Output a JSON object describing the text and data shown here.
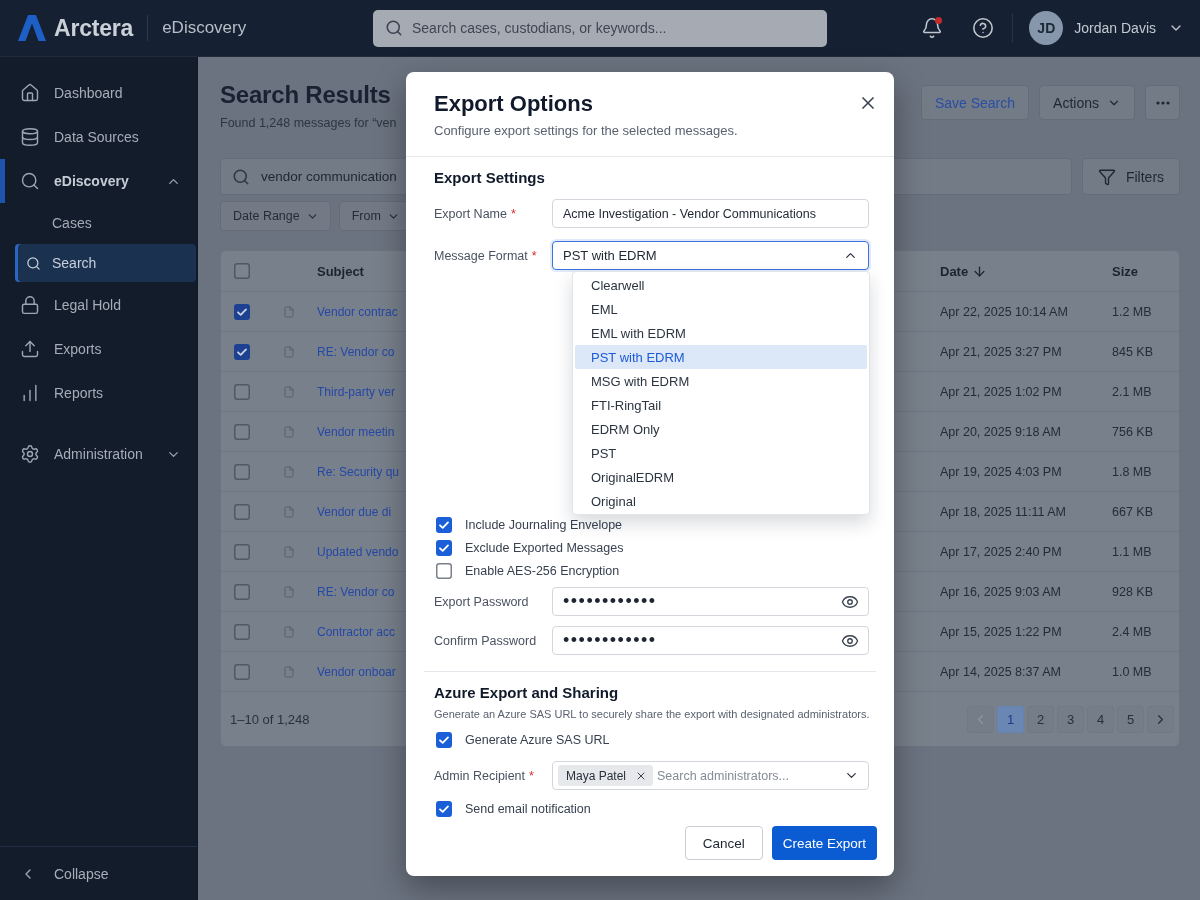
{
  "topbar": {
    "brand": "Arctera",
    "product": "eDiscovery",
    "search": {
      "placeholder": "Search cases, custodians, or keywords..."
    },
    "unread_notifications": true,
    "user": {
      "initials": "JD",
      "name": "Jordan Davis"
    }
  },
  "sidebar": {
    "sections": [
      {
        "items": [
          {
            "label": "Dashboard",
            "selected": false
          },
          {
            "label": "Data Sources",
            "selected": false
          },
          {
            "label": "eDiscovery",
            "selected": true,
            "expanded": true,
            "children": [
              {
                "label": "Cases",
                "selected": false
              },
              {
                "label": "Search",
                "selected": true
              }
            ]
          },
          {
            "label": "Legal Hold",
            "selected": false
          },
          {
            "label": "Exports",
            "selected": false
          },
          {
            "label": "Reports",
            "selected": false
          }
        ]
      },
      {
        "items": [
          {
            "label": "Administration",
            "selected": false,
            "expanded": false
          }
        ]
      }
    ],
    "collapse": "Collapse"
  },
  "page": {
    "title": "Search Results",
    "subtitle": "Found 1,248 messages for “ven",
    "save_button": "Save Search",
    "actions_button": "Actions",
    "search_value": "vendor communication",
    "filters_button": "Filters",
    "filter_chips": [
      "Date Range",
      "From"
    ]
  },
  "table": {
    "select_all_checked": false,
    "columns": [
      {
        "label": "Subject",
        "sorted": false
      },
      {
        "label": "Date",
        "sorted": true
      },
      {
        "label": "Size",
        "sorted": false
      }
    ],
    "rows": [
      {
        "checked": true,
        "subject": "Vendor contrac",
        "date": "Apr 22, 2025 10:14 AM",
        "size": "1.2 MB"
      },
      {
        "checked": true,
        "subject": "RE: Vendor co",
        "date": "Apr 21, 2025 3:27 PM",
        "size": "845 KB"
      },
      {
        "checked": false,
        "subject": "Third-party ver",
        "date": "Apr 21, 2025 1:02 PM",
        "size": "2.1 MB"
      },
      {
        "checked": false,
        "subject": "Vendor meetin",
        "date": "Apr 20, 2025 9:18 AM",
        "size": "756 KB"
      },
      {
        "checked": false,
        "subject": "Re: Security qu",
        "date": "Apr 19, 2025 4:03 PM",
        "size": "1.8 MB"
      },
      {
        "checked": false,
        "subject": "Vendor due di",
        "date": "Apr 18, 2025 11:11 AM",
        "size": "667 KB"
      },
      {
        "checked": false,
        "subject": "Updated vendo",
        "date": "Apr 17, 2025 2:40 PM",
        "size": "1.1 MB"
      },
      {
        "checked": false,
        "subject": "RE: Vendor co",
        "date": "Apr 16, 2025 9:03 AM",
        "size": "928 KB"
      },
      {
        "checked": false,
        "subject": "Contractor acc",
        "date": "Apr 15, 2025 1:22 PM",
        "size": "2.4 MB"
      },
      {
        "checked": false,
        "subject": "Vendor onboar",
        "date": "Apr 14, 2025 8:37 AM",
        "size": "1.0 MB"
      }
    ],
    "summary": "1–10 of 1,248",
    "pagination": {
      "previous_disabled": true,
      "next_disabled": false,
      "pages": [
        {
          "label": "1",
          "selected": true
        },
        {
          "label": "2",
          "selected": false
        },
        {
          "label": "3",
          "selected": false
        },
        {
          "label": "4",
          "selected": false
        },
        {
          "label": "5",
          "selected": false
        }
      ]
    }
  },
  "dialog": {
    "title": "Export Options",
    "subtitle": "Configure export settings for the selected messages.",
    "settings": {
      "heading": "Export Settings",
      "export_name": {
        "label": "Export Name",
        "required_mark": "*",
        "value": "Acme Investigation - Vendor Communications"
      },
      "message_format": {
        "label": "Message Format",
        "required_mark": "*",
        "value": "PST with EDRM",
        "expanded": true,
        "options": [
          {
            "label": "Clearwell",
            "selected": false
          },
          {
            "label": "EML",
            "selected": false
          },
          {
            "label": "EML with EDRM",
            "selected": false
          },
          {
            "label": "PST with EDRM",
            "selected": true
          },
          {
            "label": "MSG with EDRM",
            "selected": false
          },
          {
            "label": "FTI-RingTail",
            "selected": false
          },
          {
            "label": "EDRM Only",
            "selected": false
          },
          {
            "label": "PST",
            "selected": false
          },
          {
            "label": "OriginalEDRM",
            "selected": false
          },
          {
            "label": "Original",
            "selected": false
          }
        ]
      },
      "checkboxes": [
        {
          "label": "Include Journaling Envelope",
          "checked": true
        },
        {
          "label": "Exclude Exported Messages",
          "checked": true
        },
        {
          "label": "Enable AES-256 Encryption",
          "checked": false
        }
      ],
      "passwords": [
        {
          "label": "Export Password",
          "value": "••••••••••••"
        },
        {
          "label": "Confirm Password",
          "value": "••••••••••••"
        }
      ]
    },
    "azure": {
      "heading": "Azure Export and Sharing",
      "description": "Generate an Azure SAS URL to securely share the export with designated administrators.",
      "generate_url": {
        "label": "Generate Azure SAS URL",
        "checked": true
      },
      "recipient": {
        "label": "Admin Recipient",
        "required_mark": "*",
        "chips": [
          "Maya Patel"
        ],
        "placeholder": "Search administrators..."
      },
      "notify": {
        "label": "Send email notification",
        "checked": true
      }
    },
    "buttons": {
      "cancel": "Cancel",
      "create": "Create Export"
    }
  }
}
